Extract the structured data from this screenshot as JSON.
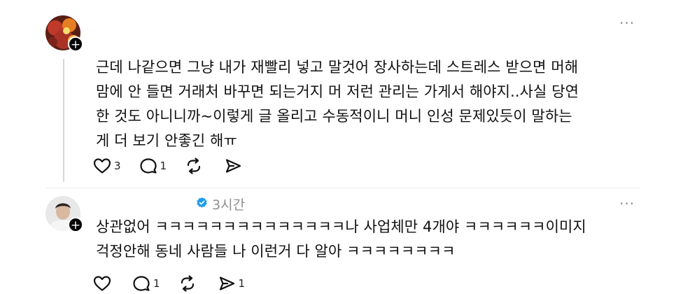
{
  "posts": [
    {
      "text": "근데 나같으면 그냥 내가 재빨리 넣고 말것어 장사하는데 스트레스 받으면 머해\n맘에 안 들면 거래처 바꾸면 되는거지 머 저런 관리는 가게서 해야지..사실 당연\n한 것도 아니니까~이렇게 글 올리고 수동적이니 머니 인성 문제있듯이 말하는\n게 더 보기 안좋긴 해ㅠ",
      "more_label": "···",
      "follow_label": "+",
      "likes": "3",
      "replies": "1",
      "reposts": "",
      "shares": ""
    },
    {
      "time": "3시간",
      "text": "상관없어 ㅋㅋㅋㅋㅋㅋㅋㅋㅋㅋㅋㅋㅋㅋ나 사업체만 4개야 ㅋㅋㅋㅋㅋㅋ이미지\n걱정안해 동네 사람들 나 이런거 다 알아 ㅋㅋㅋㅋㅋㅋㅋㅋ",
      "more_label": "···",
      "follow_label": "+",
      "likes": "",
      "replies": "1",
      "reposts": "",
      "shares": "1"
    }
  ],
  "icons": {
    "like": "heart-icon",
    "reply": "comment-bubble-icon",
    "repost": "repost-arrows-icon",
    "share": "send-paper-plane-icon",
    "verified": "verified-badge-icon",
    "more": "more-dots-icon"
  },
  "colors": {
    "verified": "#1d9bf0",
    "muted": "#8f8f8f",
    "thread_line": "#d7d7d7"
  }
}
